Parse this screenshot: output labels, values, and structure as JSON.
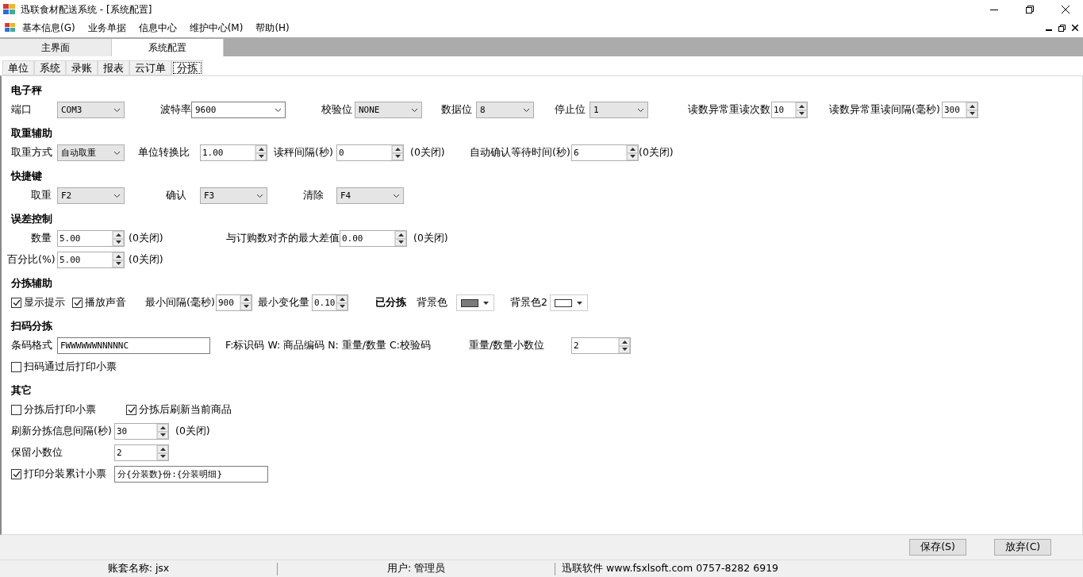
{
  "window": {
    "title": "迅联食材配送系统 - [系统配置]"
  },
  "menu": {
    "items": [
      "基本信息(G)",
      "业务单据",
      "信息中心",
      "维护中心(M)",
      "帮助(H)"
    ]
  },
  "doc_tabs": [
    {
      "label": "主界面",
      "selected": false
    },
    {
      "label": "系统配置",
      "selected": true
    }
  ],
  "tabs": [
    {
      "label": "单位",
      "selected": false
    },
    {
      "label": "系统",
      "selected": false
    },
    {
      "label": "录账",
      "selected": false
    },
    {
      "label": "报表",
      "selected": false
    },
    {
      "label": "云订单",
      "selected": false
    },
    {
      "label": "分拣",
      "selected": true
    }
  ],
  "sections": [
    {
      "title": "电子秤",
      "rows": [
        {
          "items": [
            {
              "kind": "label",
              "text": "端口"
            },
            {
              "kind": "combo",
              "value": "COM3",
              "editable": false
            },
            {
              "kind": "label",
              "text": "波特率"
            },
            {
              "kind": "combo",
              "value": "9600",
              "editable": true
            },
            {
              "kind": "label",
              "text": "校验位"
            },
            {
              "kind": "combo",
              "value": "NONE",
              "editable": false
            },
            {
              "kind": "label",
              "text": "数据位"
            },
            {
              "kind": "combo",
              "value": "8",
              "editable": false
            },
            {
              "kind": "label",
              "text": "停止位"
            },
            {
              "kind": "combo",
              "value": "1",
              "editable": false
            },
            {
              "kind": "label",
              "text": "读数异常重读次数"
            },
            {
              "kind": "spin",
              "value": "10"
            },
            {
              "kind": "label",
              "text": "读数异常重读间隔(毫秒)"
            },
            {
              "kind": "spin",
              "value": "300"
            }
          ]
        }
      ]
    },
    {
      "title": "取重辅助",
      "rows": [
        {
          "items": [
            {
              "kind": "label",
              "text": "取重方式"
            },
            {
              "kind": "combo",
              "value": "自动取重",
              "editable": false
            },
            {
              "kind": "label",
              "text": "单位转换比"
            },
            {
              "kind": "spin",
              "value": "1.00"
            },
            {
              "kind": "label",
              "text": "读秤间隔(秒)"
            },
            {
              "kind": "spin",
              "value": "0"
            },
            {
              "kind": "note",
              "text": "(0关闭)"
            },
            {
              "kind": "label",
              "text": "自动确认等待时间(秒)"
            },
            {
              "kind": "spin",
              "value": "6"
            },
            {
              "kind": "note",
              "text": "(0关闭)"
            }
          ]
        }
      ]
    },
    {
      "title": "快捷键",
      "rows": [
        {
          "items": [
            {
              "kind": "label",
              "text": "取重"
            },
            {
              "kind": "combo",
              "value": "F2",
              "editable": false
            },
            {
              "kind": "label",
              "text": "确认"
            },
            {
              "kind": "combo",
              "value": "F3",
              "editable": false
            },
            {
              "kind": "label",
              "text": "清除"
            },
            {
              "kind": "combo",
              "value": "F4",
              "editable": false
            }
          ]
        }
      ]
    },
    {
      "title": "误差控制",
      "rows": [
        {
          "items": [
            {
              "kind": "label",
              "text": "数量"
            },
            {
              "kind": "spin",
              "value": "5.00"
            },
            {
              "kind": "note",
              "text": "(0关闭)"
            },
            {
              "kind": "label",
              "text": "与订购数对齐的最大差值"
            },
            {
              "kind": "spin",
              "value": "0.00"
            },
            {
              "kind": "note",
              "text": "(0关闭)"
            }
          ]
        },
        {
          "items": [
            {
              "kind": "label",
              "text": "百分比(%)"
            },
            {
              "kind": "spin",
              "value": "5.00"
            },
            {
              "kind": "note",
              "text": "(0关闭)"
            }
          ]
        }
      ]
    },
    {
      "title": "分拣辅助",
      "rows": [
        {
          "items": [
            {
              "kind": "check",
              "label": "显示提示",
              "checked": true
            },
            {
              "kind": "check",
              "label": "播放声音",
              "checked": true
            },
            {
              "kind": "label",
              "text": "最小间隔(毫秒)"
            },
            {
              "kind": "spin",
              "value": "900"
            },
            {
              "kind": "label",
              "text": "最小变化量"
            },
            {
              "kind": "spin",
              "value": "0.10"
            },
            {
              "kind": "strong",
              "text": "已分拣"
            },
            {
              "kind": "label",
              "text": "背景色"
            },
            {
              "kind": "color",
              "color": "#7a7a7a"
            },
            {
              "kind": "label",
              "text": "背景色2"
            },
            {
              "kind": "color",
              "color": "#ffffff"
            }
          ]
        }
      ]
    },
    {
      "title": "扫码分拣",
      "rows": [
        {
          "items": [
            {
              "kind": "label",
              "text": "条码格式"
            },
            {
              "kind": "text",
              "value": "FWWWWWWNNNNNC"
            },
            {
              "kind": "note",
              "text": "F:标识码  W: 商品编码  N: 重量/数量  C:校验码"
            },
            {
              "kind": "label",
              "text": "重量/数量小数位"
            },
            {
              "kind": "spin",
              "value": "2"
            }
          ]
        },
        {
          "items": [
            {
              "kind": "check",
              "label": "扫码通过后打印小票",
              "checked": false
            }
          ]
        }
      ]
    },
    {
      "title": "其它",
      "rows": [
        {
          "items": [
            {
              "kind": "check",
              "label": "分拣后打印小票",
              "checked": false
            },
            {
              "kind": "check",
              "label": "分拣后刷新当前商品",
              "checked": true
            }
          ]
        },
        {
          "items": [
            {
              "kind": "label",
              "text": "刷新分拣信息间隔(秒)"
            },
            {
              "kind": "spin",
              "value": "30"
            },
            {
              "kind": "note",
              "text": "(0关闭)"
            }
          ]
        },
        {
          "items": [
            {
              "kind": "label",
              "text": "保留小数位"
            },
            {
              "kind": "spin",
              "value": "2"
            }
          ]
        },
        {
          "items": [
            {
              "kind": "check",
              "label": "打印分装累计小票",
              "checked": true
            },
            {
              "kind": "text",
              "value": "分{分装数}份:{分装明细}"
            }
          ]
        }
      ]
    }
  ],
  "buttons": [
    "保存(S)",
    "放弃(C)"
  ],
  "status_bar": [
    "账套名称:  jsx",
    "用户:  管理员",
    "迅联软件  www.fsxlsoft.com 0757-8282 6919"
  ]
}
